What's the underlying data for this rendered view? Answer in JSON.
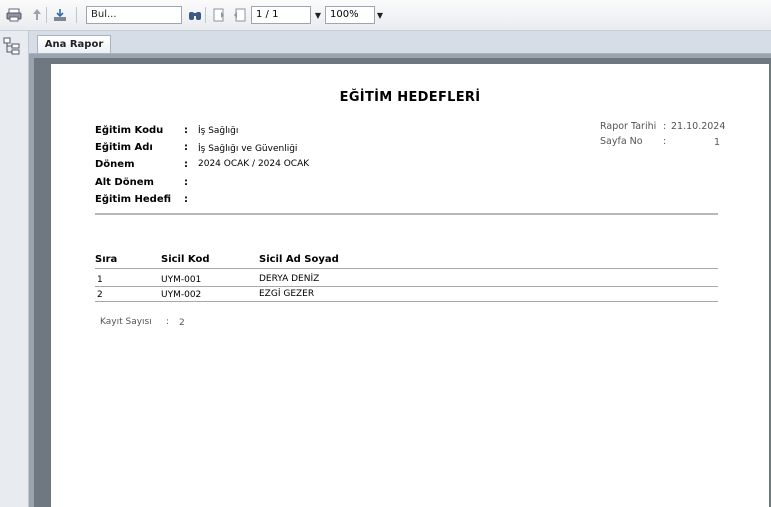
{
  "toolbar": {
    "search_placeholder": "Bul...",
    "page_value": "1 / 1",
    "zoom_value": "100%"
  },
  "tabs": [
    {
      "label": "Ana Rapor"
    }
  ],
  "report": {
    "title": "EĞİTİM HEDEFLERİ",
    "fields": [
      {
        "label": "Eğitim Kodu",
        "value": "İş Sağlığı"
      },
      {
        "label": "Eğitim Adı",
        "value": "İş Sağlığı ve Güvenliği"
      },
      {
        "label": "Dönem",
        "value": "2024 OCAK / 2024 OCAK"
      },
      {
        "label": "Alt Dönem",
        "value": ""
      },
      {
        "label": "Eğitim Hedefi",
        "value": ""
      }
    ],
    "meta": [
      {
        "label": "Rapor Tarihi",
        "value": "21.10.2024"
      },
      {
        "label": "Sayfa No",
        "value": "1"
      }
    ],
    "table": {
      "headers": [
        "Sıra",
        "Sicil Kod",
        "Sicil Ad Soyad"
      ],
      "rows": [
        [
          "1",
          "UYM-001",
          "DERYA DENİZ"
        ],
        [
          "2",
          "UYM-002",
          "EZGİ GEZER"
        ]
      ]
    },
    "record_count_label": "Kayıt Sayısı",
    "record_count": "2",
    "colon": ":"
  },
  "colors": {
    "toolbar_bg": "#e9ecef",
    "viewer_bg": "#6f7780",
    "tab_strip": "#d6dde6"
  }
}
